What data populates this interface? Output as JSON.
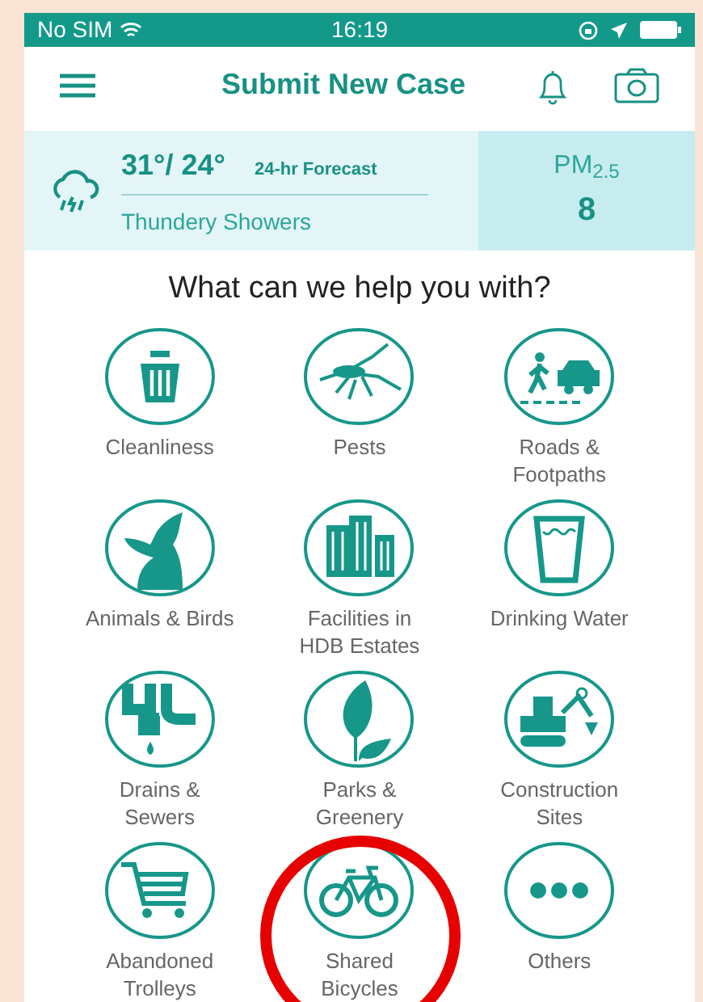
{
  "status_bar": {
    "carrier": "No SIM",
    "time": "16:19"
  },
  "header": {
    "title": "Submit New Case"
  },
  "weather": {
    "temperature": "31°/ 24°",
    "forecast_label": "24-hr Forecast",
    "condition": "Thundery Showers"
  },
  "air_quality": {
    "label": "PM$_{2.5}$",
    "value": "8"
  },
  "prompt": "What can we help you with?",
  "categories": [
    {
      "label": "Cleanliness",
      "highlighted": false
    },
    {
      "label": "Pests",
      "highlighted": false
    },
    {
      "label": "Roads & Footpaths",
      "highlighted": false
    },
    {
      "label": "Animals & Birds",
      "highlighted": false
    },
    {
      "label": "Facilities in HDB Estates",
      "highlighted": false
    },
    {
      "label": "Drinking Water",
      "highlighted": false
    },
    {
      "label": "Drains & Sewers",
      "highlighted": false
    },
    {
      "label": "Parks & Greenery",
      "highlighted": false
    },
    {
      "label": "Construction Sites",
      "highlighted": false
    },
    {
      "label": "Abandoned Trolleys",
      "highlighted": false
    },
    {
      "label": "Shared Bicycles",
      "highlighted": true
    },
    {
      "label": "Others",
      "highlighted": false
    }
  ]
}
